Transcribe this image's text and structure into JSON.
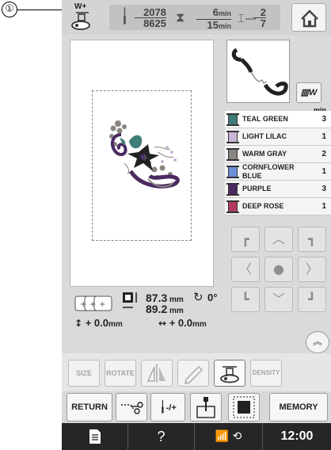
{
  "callout": {
    "number": "①"
  },
  "header": {
    "presser_foot_label": "W+",
    "stitch_count_current": "2078",
    "stitch_count_total": "8625",
    "time_current": "6",
    "time_total": "15",
    "time_unit": "min",
    "color_current": "2",
    "color_total": "7"
  },
  "thumbnail": {
    "button_label": "▥W"
  },
  "color_list": {
    "minutes_header": "min",
    "items": [
      {
        "name": "TEAL GREEN",
        "minutes": "3",
        "color": "#3f7d78"
      },
      {
        "name": "LIGHT LILAC",
        "minutes": "1",
        "color": "#c9b5d6"
      },
      {
        "name": "WARM GRAY",
        "minutes": "2",
        "color": "#8a8580"
      },
      {
        "name": "CORNFLOWER BLUE",
        "name_line1": "CORNFLOWER",
        "name_line2": "BLUE",
        "minutes": "1",
        "color": "#6b8fd6"
      },
      {
        "name": "PURPLE",
        "minutes": "3",
        "color": "#4b2a62"
      },
      {
        "name": "DEEP ROSE",
        "minutes": "1",
        "color": "#b03a5b"
      }
    ]
  },
  "size_info": {
    "height_value": "87.3",
    "width_value": "89.2",
    "unit": "mm",
    "rotation_value": "0°",
    "offset_y_value": "0.0",
    "offset_x_value": "0.0",
    "offset_y_sign": "+",
    "offset_x_sign": "+"
  },
  "edit_toolbar": {
    "size_label": "SIZE",
    "rotate_label": "ROTATE",
    "density_label": "DENSITY"
  },
  "bottom_toolbar": {
    "return_label": "RETURN",
    "needle_label": "-/+",
    "memory_label": "MEMORY"
  },
  "status_bar": {
    "help_label": "?",
    "clock": "12:00"
  },
  "icons": {
    "home": "home-icon",
    "pencil": "pencil-icon",
    "mirror": "mirror-icon",
    "embroidery": "embroidery-icon",
    "scissors": "scissors-icon",
    "page": "page-icon"
  }
}
